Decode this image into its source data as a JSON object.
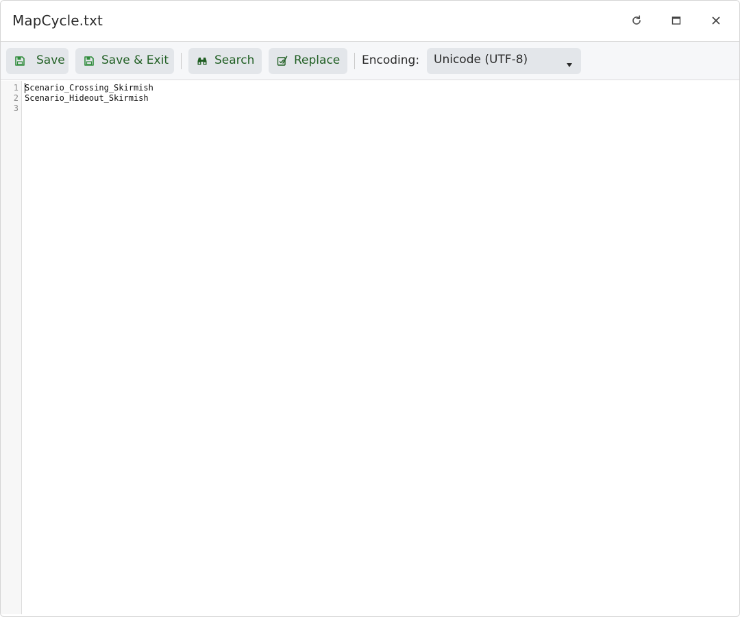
{
  "window": {
    "title": "MapCycle.txt"
  },
  "controls": {
    "refresh_icon": "refresh-icon",
    "maximize_icon": "maximize-icon",
    "close_icon": "close-icon"
  },
  "toolbar": {
    "save_label": "Save",
    "save_exit_label": "Save & Exit",
    "search_label": "Search",
    "replace_label": "Replace",
    "encoding_label": "Encoding:",
    "encoding_value": "Unicode (UTF-8)"
  },
  "editor": {
    "line_numbers": [
      "1",
      "2",
      "3"
    ],
    "lines": [
      "Scenario_Crossing_Skirmish",
      "Scenario_Hideout_Skirmish",
      ""
    ]
  },
  "colors": {
    "accent_green": "#1f5e22",
    "icon_green": "#2e8b3a",
    "button_bg": "#e3e6ea"
  }
}
